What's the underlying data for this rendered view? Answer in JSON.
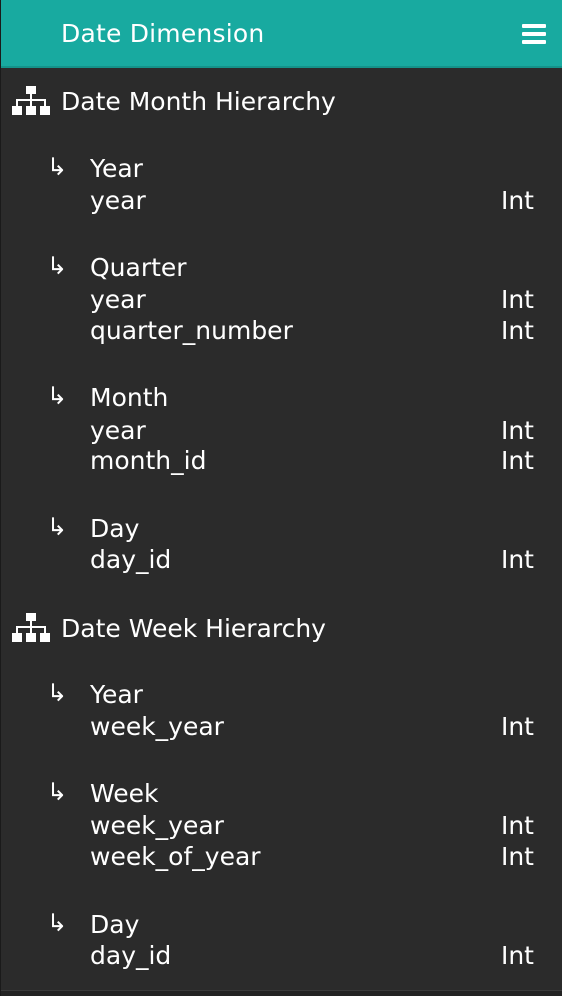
{
  "header": {
    "title": "Date Dimension",
    "menu_icon": "hamburger-menu-icon"
  },
  "hierarchies": [
    {
      "title": "Date Month Hierarchy",
      "icon": "sitemap-icon",
      "levels": [
        {
          "name": "Year",
          "attributes": [
            {
              "name": "year",
              "type": "Int"
            }
          ]
        },
        {
          "name": "Quarter",
          "attributes": [
            {
              "name": "year",
              "type": "Int"
            },
            {
              "name": "quarter_number",
              "type": "Int"
            }
          ]
        },
        {
          "name": "Month",
          "attributes": [
            {
              "name": "year",
              "type": "Int"
            },
            {
              "name": "month_id",
              "type": "Int"
            }
          ]
        },
        {
          "name": "Day",
          "attributes": [
            {
              "name": "day_id",
              "type": "Int"
            }
          ]
        }
      ]
    },
    {
      "title": "Date Week Hierarchy",
      "icon": "sitemap-icon",
      "levels": [
        {
          "name": "Year",
          "attributes": [
            {
              "name": "week_year",
              "type": "Int"
            }
          ]
        },
        {
          "name": "Week",
          "attributes": [
            {
              "name": "week_year",
              "type": "Int"
            },
            {
              "name": "week_of_year",
              "type": "Int"
            }
          ]
        },
        {
          "name": "Day",
          "attributes": [
            {
              "name": "day_id",
              "type": "Int"
            }
          ]
        }
      ]
    }
  ],
  "colors": {
    "header_bg": "#18aaa0",
    "panel_bg": "#2b2b2b",
    "text": "#ffffff"
  }
}
